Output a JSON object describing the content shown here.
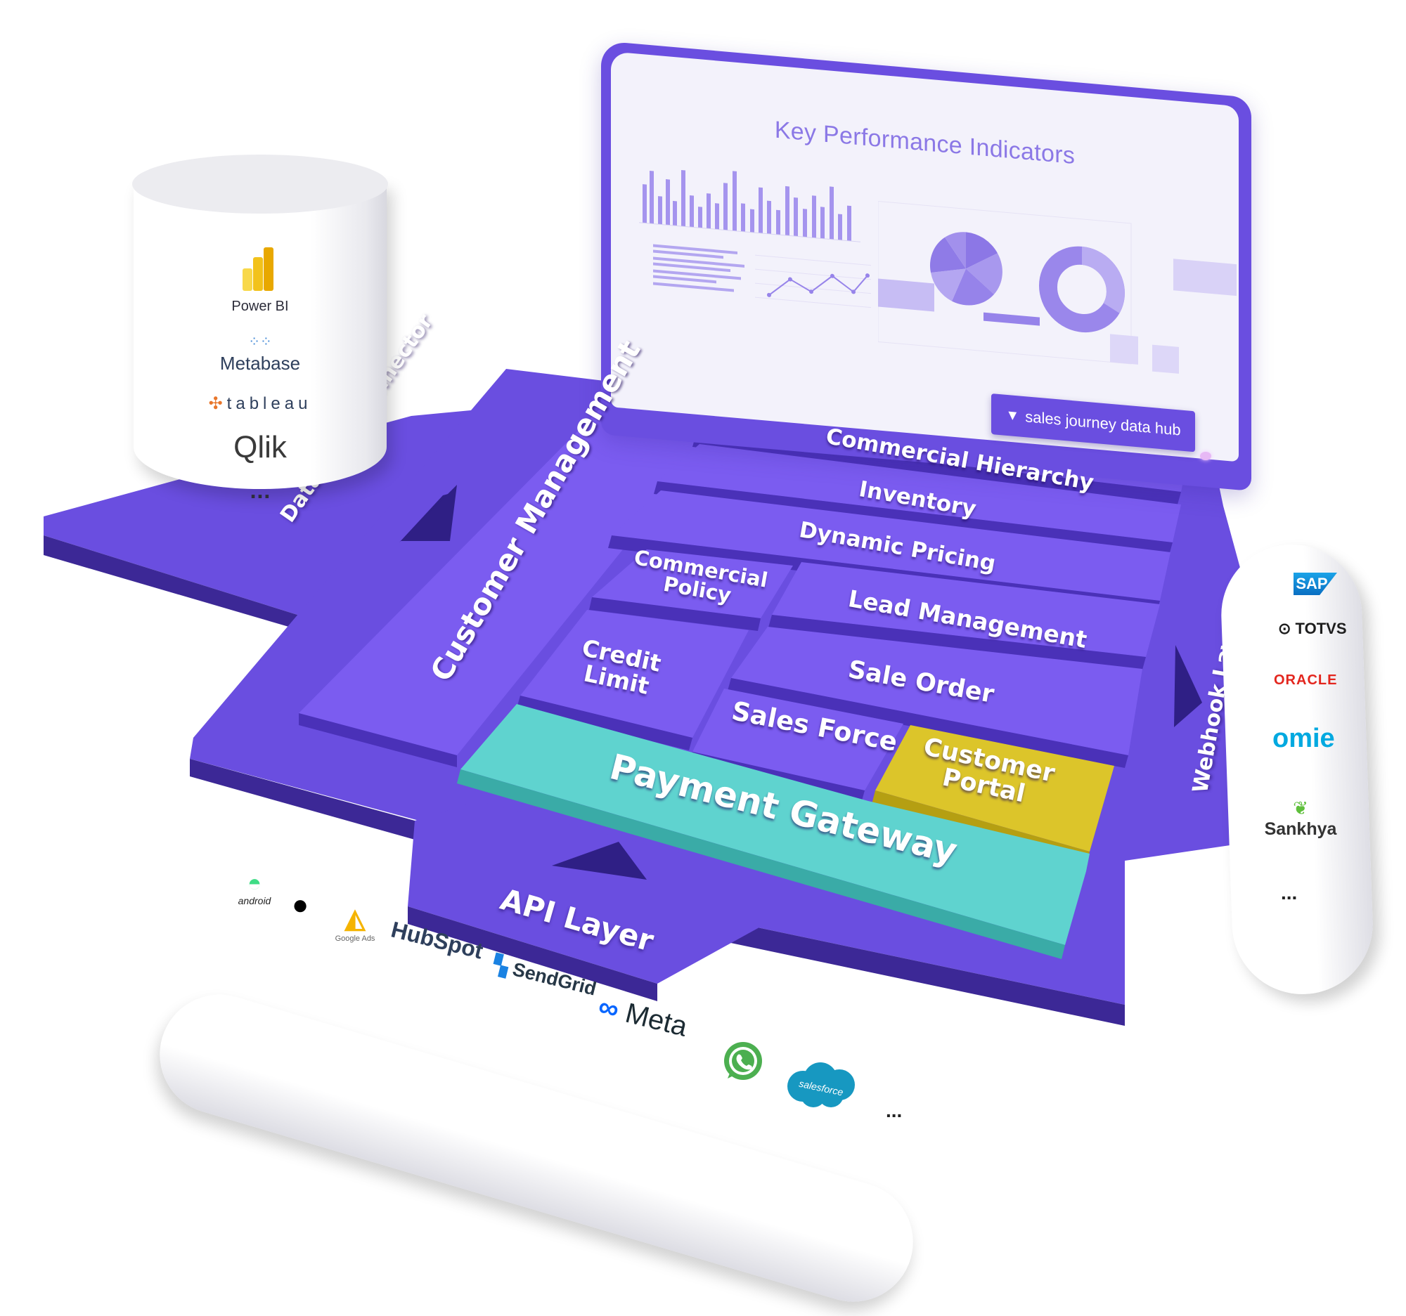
{
  "screen": {
    "title": "Key Performance Indicators",
    "brand": "sales journey data hub"
  },
  "connectors": {
    "data_lake": "Data Lake Connector",
    "webhook": "Webhook Layer",
    "api": "API Layer"
  },
  "modules": {
    "customer_management": "Customer Management",
    "commercial_hierarchy": "Commercial Hierarchy",
    "inventory": "Inventory",
    "dynamic_pricing": "Dynamic Pricing",
    "commercial_policy_1": "Commercial",
    "commercial_policy_2": "Policy",
    "lead_management": "Lead Management",
    "credit_limit_1": "Credit",
    "credit_limit_2": "Limit",
    "sale_order": "Sale Order",
    "sales_force": "Sales Force",
    "customer_portal_1": "Customer",
    "customer_portal_2": "Portal",
    "payment_gateway": "Payment Gateway"
  },
  "bi_tools": {
    "power_bi": "Power BI",
    "metabase": "Metabase",
    "tableau": "tableau",
    "qlik": "Qlik",
    "more": "..."
  },
  "api_integrations": {
    "android": "android",
    "google_ads": "Google Ads",
    "hubspot": "HubSpot",
    "sendgrid": "SendGrid",
    "meta": "Meta",
    "salesforce": "salesforce",
    "more": "..."
  },
  "webhook_integrations": {
    "sap": "SAP",
    "totvs": "TOTVS",
    "oracle": "ORACLE",
    "omie": "omie",
    "sankhya": "Sankhya",
    "more": "..."
  },
  "colors": {
    "platform": "#6a4ee0",
    "platform_dark": "#4a31b8",
    "module": "#7b5cf0",
    "payment_gateway": "#5fd3cf",
    "customer_portal": "#dcc52a",
    "screen_bg": "#f3f2fb",
    "kpi_title": "#8b78e6"
  }
}
